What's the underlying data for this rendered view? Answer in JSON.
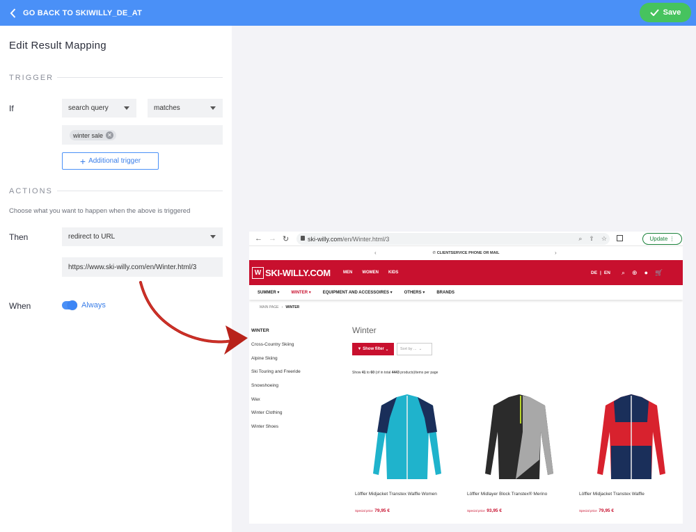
{
  "topbar": {
    "back_label": "GO BACK TO SKIWILLY_DE_AT",
    "save_label": "Save"
  },
  "editor": {
    "title": "Edit Result Mapping",
    "trigger": {
      "heading": "TRIGGER",
      "if_label": "If",
      "field_select": "search query",
      "operator_select": "matches",
      "tags": [
        "winter sale"
      ],
      "add_trigger_label": "Additional trigger"
    },
    "actions": {
      "heading": "ACTIONS",
      "helper": "Choose what you want to happen when the above is triggered",
      "then_label": "Then",
      "action_select": "redirect to URL",
      "url_value": "https://www.ski-willy.com/en/Winter.html/3",
      "when_label": "When",
      "when_toggle_on": true,
      "when_value": "Always"
    }
  },
  "preview": {
    "browser": {
      "url_host": "ski-willy.com",
      "url_path": "/en/Winter.html/3",
      "update_label": "Update"
    },
    "site": {
      "promo": "CLIENTSERVICE PHONE OR MAIL",
      "logo_mark": "W",
      "logo_text": "SKI-WILLY.COM",
      "top_nav": [
        "MEN",
        "WOMEN",
        "KIDS"
      ],
      "lang_de": "DE",
      "lang_en": "EN",
      "category_nav": [
        "SUMMER",
        "WINTER",
        "EQUIPMENT AND ACCESSOIRES",
        "OTHERS",
        "BRANDS"
      ],
      "breadcrumb_home": "MAIN PAGE",
      "breadcrumb_current": "WINTER",
      "sidebar_title": "WINTER",
      "sidebar_items": [
        "Cross-Country Skiing",
        "Alpine Skiing",
        "Ski Touring and Freeride",
        "Snowshoeing",
        "Wax",
        "Winter Clothing",
        "Winter Shoes"
      ],
      "category_title": "Winter",
      "filter_label": "Show filter",
      "sort_placeholder": "Sort by ...",
      "count": {
        "prefix": "Show",
        "from": "41",
        "to_word": "to",
        "to": "60",
        "of_total": "(of in total",
        "total": "4443",
        "suffix": "products)Items per page"
      },
      "products": [
        {
          "name": "Löffler Midjacket Transtex Waffle Women",
          "price_label": "Special price",
          "price": "79,95 €",
          "colors": {
            "body": "#1fb3cc",
            "accent": "#1a2f5a"
          }
        },
        {
          "name": "Löffler Midlayer Block Transtex® Merino",
          "price_label": "Special price",
          "price": "93,95 €",
          "colors": {
            "body": "#2b2b2b",
            "accent": "#a8a8a8"
          }
        },
        {
          "name": "Löffler Midjacket Transtex Waffle",
          "price_label": "Special price",
          "price": "79,95 €",
          "colors": {
            "body": "#d8222e",
            "accent": "#1a2f5a"
          }
        }
      ]
    }
  },
  "colors": {
    "primary": "#4a90f7",
    "save": "#46c35e",
    "brand_red": "#c8102e",
    "arrow": "#b8221a"
  }
}
